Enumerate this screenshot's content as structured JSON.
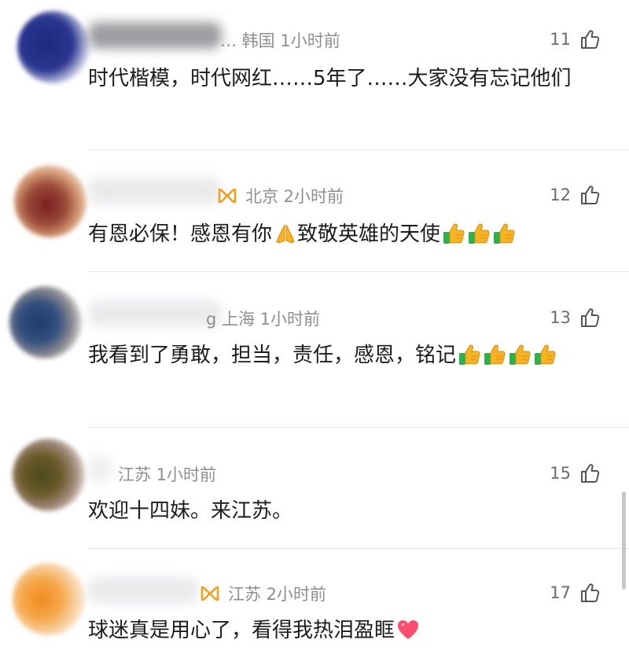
{
  "comments": [
    {
      "meta_text": "… 韩国 1小时前",
      "likes": "11",
      "text": "时代楷模，时代网红……5年了……大家没有忘记他们",
      "emojis": []
    },
    {
      "meta_text": "北京 2小时前",
      "likes": "12",
      "text_before": "有恩必保！感恩有你",
      "text_after": "致敬英雄的天使",
      "emojis": [
        "folded-hands",
        "thumbs-up",
        "thumbs-up",
        "thumbs-up"
      ]
    },
    {
      "meta_text": "g 上海 1小时前",
      "likes": "13",
      "text": "我看到了勇敢，担当，责任，感恩，铭记",
      "emojis": [
        "thumbs-up",
        "thumbs-up",
        "thumbs-up",
        "thumbs-up"
      ]
    },
    {
      "meta_text": "江苏 1小时前",
      "likes": "15",
      "text": "欢迎十四妹。来江苏。",
      "emojis": []
    },
    {
      "meta_text": "江苏 2小时前",
      "likes": "17",
      "text": "球迷真是用心了，看得我热泪盈眶",
      "emojis": [
        "red-heart"
      ]
    }
  ],
  "colors": {
    "vip_gold": "#f0a020",
    "thumb_yellow": "#f5b325",
    "thumb_cuff": "#2bb24c",
    "heart": "#ff4b6e"
  }
}
